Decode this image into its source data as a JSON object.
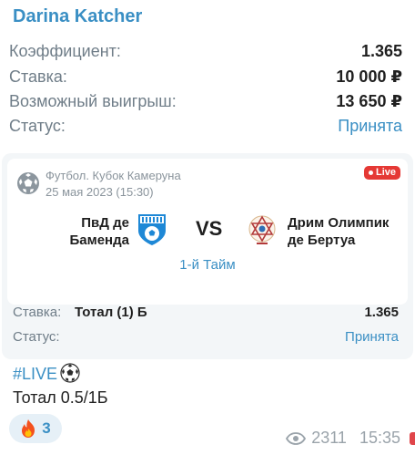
{
  "message": {
    "author": "Darina Katcher",
    "summary": [
      {
        "label": "Коэффициент:",
        "value": "1.365"
      },
      {
        "label": "Ставка:",
        "value": "10 000 ₽"
      },
      {
        "label": "Возможный выигрыш:",
        "value": "13 650 ₽"
      },
      {
        "label": "Статус:",
        "value": "Принята"
      }
    ],
    "hashtag": "#LIVE",
    "total_text": "Тотал 0.5/1Б",
    "reaction": {
      "icon": "fire-icon",
      "count": "3"
    },
    "views": "2311",
    "time": "15:35"
  },
  "card": {
    "league": "Футбол. Кубок Камеруна",
    "date": "25 мая 2023 (15:30)",
    "live_label": "Live",
    "team1": {
      "line1": "ПвД де",
      "line2": "Баменда"
    },
    "vs": "VS",
    "team2": {
      "line1": "Дрим Олимпик",
      "line2": "де Бертуа"
    },
    "period": "1-й Тайм",
    "bet": {
      "label": "Ставка:",
      "market": "Тотал (1) Б",
      "odds": "1.365"
    },
    "status": {
      "label": "Статус:",
      "value": "Принята"
    }
  },
  "colors": {
    "accent": "#3a8fc4",
    "muted": "#6f7d88",
    "live": "#e53935",
    "card_bg": "#f3f6f8"
  }
}
